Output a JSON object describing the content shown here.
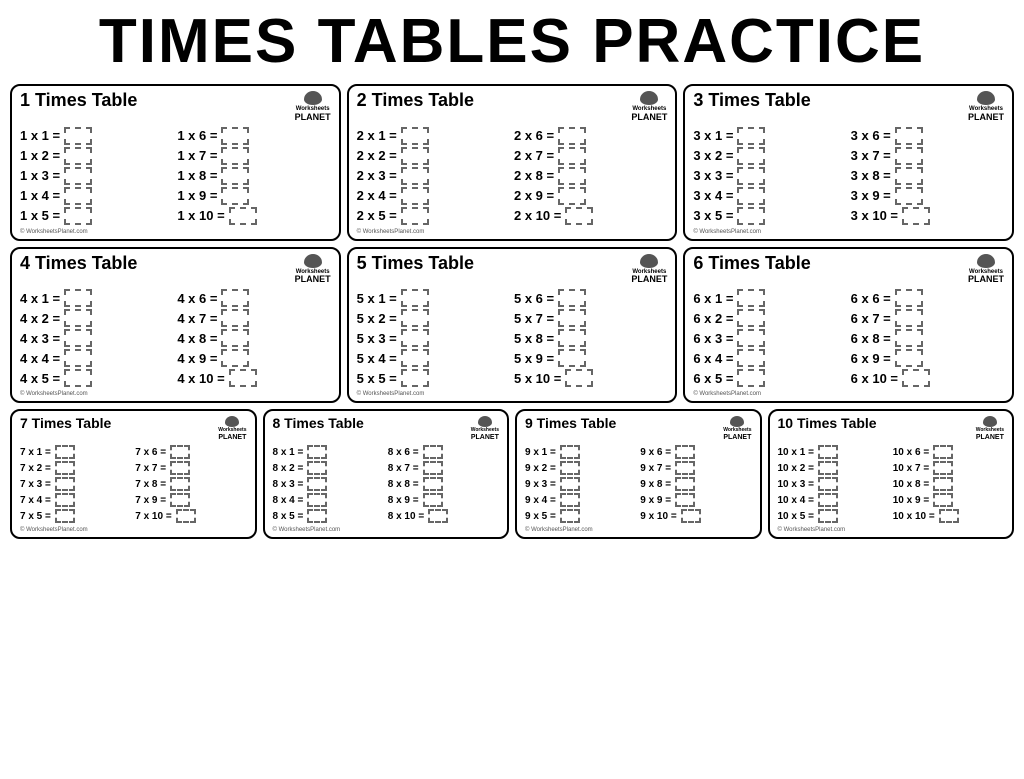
{
  "title": "TIMES TABLES PRACTICE",
  "website": "© WorksheetsPlanet.com",
  "tables": [
    {
      "id": 1,
      "title": "1 Times Table",
      "equations_left": [
        "1 x 1 =",
        "1 x 2 =",
        "1 x 3 =",
        "1 x 4 =",
        "1 x 5 ="
      ],
      "equations_right": [
        "1 x 6 =",
        "1 x 7 =",
        "1 x 8 =",
        "1 x 9 =",
        "1 x 10 ="
      ]
    },
    {
      "id": 2,
      "title": "2 Times Table",
      "equations_left": [
        "2 x 1 =",
        "2 x 2 =",
        "2 x 3 =",
        "2 x 4 =",
        "2 x 5 ="
      ],
      "equations_right": [
        "2 x 6 =",
        "2 x 7 =",
        "2 x 8 =",
        "2 x 9 =",
        "2 x 10 ="
      ]
    },
    {
      "id": 3,
      "title": "3 Times Table",
      "equations_left": [
        "3 x 1 =",
        "3 x 2 =",
        "3 x 3 =",
        "3 x 4 =",
        "3 x 5 ="
      ],
      "equations_right": [
        "3 x 6 =",
        "3 x 7 =",
        "3 x 8 =",
        "3 x 9 =",
        "3 x 10 ="
      ]
    },
    {
      "id": 4,
      "title": "4 Times Table",
      "equations_left": [
        "4 x 1 =",
        "4 x 2 =",
        "4 x 3 =",
        "4 x 4 =",
        "4 x 5 ="
      ],
      "equations_right": [
        "4 x 6 =",
        "4 x 7 =",
        "4 x 8 =",
        "4 x 9 =",
        "4 x 10 ="
      ]
    },
    {
      "id": 5,
      "title": "5 Times Table",
      "equations_left": [
        "5 x 1 =",
        "5 x 2 =",
        "5 x 3 =",
        "5 x 4 =",
        "5 x 5 ="
      ],
      "equations_right": [
        "5 x 6 =",
        "5 x 7 =",
        "5 x 8 =",
        "5 x 9 =",
        "5 x 10 ="
      ]
    },
    {
      "id": 6,
      "title": "6 Times Table",
      "equations_left": [
        "6 x 1 =",
        "6 x 2 =",
        "6 x 3 =",
        "6 x 4 =",
        "6 x 5 ="
      ],
      "equations_right": [
        "6 x 6 =",
        "6 x 7 =",
        "6 x 8 =",
        "6 x 9 =",
        "6 x 10 ="
      ]
    },
    {
      "id": 7,
      "title": "7 Times Table",
      "equations_left": [
        "7 x 1 =",
        "7 x 2 =",
        "7 x 3 =",
        "7 x 4 =",
        "7 x 5 ="
      ],
      "equations_right": [
        "7 x 6 =",
        "7 x 7 =",
        "7 x 8 =",
        "7 x 9 =",
        "7 x 10 ="
      ]
    },
    {
      "id": 8,
      "title": "8 Times Table",
      "equations_left": [
        "8 x 1 =",
        "8 x 2 =",
        "8 x 3 =",
        "8 x 4 =",
        "8 x 5 ="
      ],
      "equations_right": [
        "8 x 6 =",
        "8 x 7 =",
        "8 x 8 =",
        "8 x 9 =",
        "8 x 10 ="
      ]
    },
    {
      "id": 9,
      "title": "9 Times Table",
      "equations_left": [
        "9 x 1 =",
        "9 x 2 =",
        "9 x 3 =",
        "9 x 4 =",
        "9 x 5 ="
      ],
      "equations_right": [
        "9 x 6 =",
        "9 x 7 =",
        "9 x 8 =",
        "9 x 9 =",
        "9 x 10 ="
      ]
    },
    {
      "id": 10,
      "title": "10 Times Table",
      "equations_left": [
        "10 x 1 =",
        "10 x 2 =",
        "10 x 3 =",
        "10 x 4 =",
        "10 x 5 ="
      ],
      "equations_right": [
        "10 x 6 =",
        "10 x 7 =",
        "10 x 8 =",
        "10 x 9 =",
        "10 x 10 ="
      ]
    }
  ]
}
